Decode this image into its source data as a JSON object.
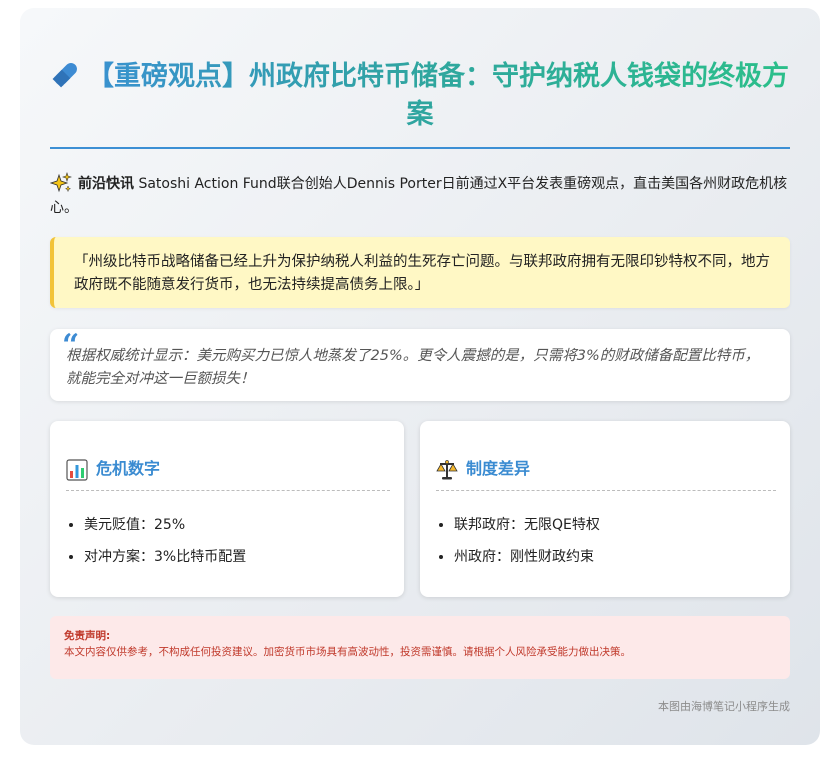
{
  "title": "【重磅观点】州政府比特币储备：守护纳税人钱袋的终极方案",
  "intro": {
    "tag": "前沿快讯",
    "text": " Satoshi Action Fund联合创始人Dennis Porter日前通过X平台发表重磅观点，直击美国各州财政危机核心。"
  },
  "quote": "「州级比特币战略储备已经上升为保护纳税人利益的生死存亡问题。与联邦政府拥有无限印钞特权不同，地方政府既不能随意发行货币，也无法持续提高债务上限。」",
  "stat": {
    "mark": "“",
    "text": "根据权威统计显示：美元购买力已惊人地蒸发了25%。更令人震撼的是，只需将3%的财政储备配置比特币，就能完全对冲这一巨额损失！"
  },
  "panels": [
    {
      "title": "危机数字",
      "icon": "bar-chart-icon",
      "items": [
        "美元贬值：25%",
        "对冲方案：3%比特币配置"
      ]
    },
    {
      "title": "制度差异",
      "icon": "scales-icon",
      "items": [
        "联邦政府：无限QE特权",
        "州政府：刚性财政约束"
      ]
    }
  ],
  "disclaimer": {
    "title": "免责声明:",
    "text": "本文内容仅供参考，不构成任何投资建议。加密货币市场具有高波动性，投资需谨慎。请根据个人风险承受能力做出决策。"
  },
  "footer": "本图由海博笔记小程序生成",
  "colors": {
    "accent_blue": "#3a8bd1",
    "accent_teal": "#2bbf8a",
    "quote_bg": "#fff8c5",
    "quote_border": "#f2c337",
    "disclaimer_bg": "#fde9e9",
    "disclaimer_text": "#c0392b"
  }
}
